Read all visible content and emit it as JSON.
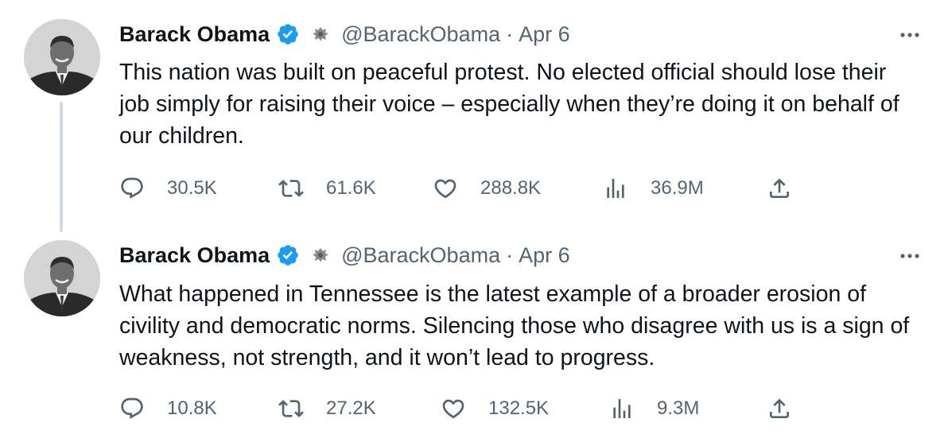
{
  "tweets": [
    {
      "author": "Barack Obama",
      "handle": "@BarackObama",
      "separator": "·",
      "date": "Apr 6",
      "text": "This nation was built on peaceful protest. No elected official should lose their job simply for raising their voice – especially when they’re doing it on behalf of our children.",
      "replies": "30.5K",
      "retweets": "61.6K",
      "likes": "288.8K",
      "views": "36.9M"
    },
    {
      "author": "Barack Obama",
      "handle": "@BarackObama",
      "separator": "·",
      "date": "Apr 6",
      "text": "What happened in Tennessee is the latest example of a broader erosion of civility and democratic norms. Silencing those who disagree with us is a sign of weakness, not strength, and it won’t lead to progress.",
      "replies": "10.8K",
      "retweets": "27.2K",
      "likes": "132.5K",
      "views": "9.3M"
    }
  ],
  "icons": {
    "reply": "reply-icon",
    "retweet": "retweet-icon",
    "like": "heart-icon",
    "views": "views-icon",
    "share": "share-icon",
    "more": "more-icon",
    "verified": "verified-badge-icon",
    "affiliate": "seal-icon"
  },
  "colors": {
    "text": "#0f1419",
    "secondary": "#536471",
    "verified": "#1d9bf0",
    "thread_line": "#cfd9de"
  }
}
